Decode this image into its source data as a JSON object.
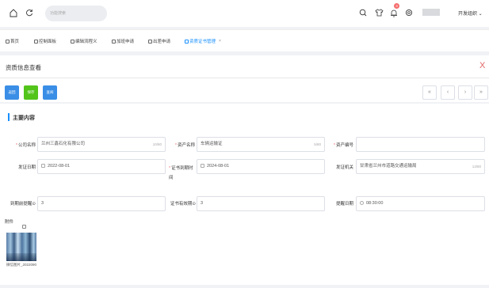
{
  "header": {
    "search_placeholder": "功能搜索",
    "notification_count": "3",
    "org_label": "开发组织"
  },
  "tabs": [
    {
      "label": "首页"
    },
    {
      "label": "控制面板"
    },
    {
      "label": "编辑流程义"
    },
    {
      "label": "加班申请"
    },
    {
      "label": "出差申请"
    },
    {
      "label": "资质证书管理"
    }
  ],
  "panel": {
    "title": "资质信息查看",
    "close_glyph": "X"
  },
  "actions": {
    "return_label": "返回",
    "save_label": "保存",
    "view_label": "查阅"
  },
  "pager": [
    "«",
    "‹",
    "›",
    "»"
  ],
  "section": {
    "title": "主要内容"
  },
  "form": {
    "company_name_label": "公司名称",
    "company_name_value": "兰州三鑫石化有限公司",
    "company_name_count": "10/80",
    "asset_name_label": "资产名称",
    "asset_name_value": "车辆运输证",
    "asset_name_count": "5/80",
    "asset_no_label": "资产编号",
    "asset_no_value": "",
    "issue_date_label": "发证日期",
    "issue_date_value": "2022-08-01",
    "expire_label": "证书到期时间",
    "expire_value": "2024-08-01",
    "authority_label": "发证机关",
    "authority_value": "甘肃省兰州市道路交通运输局",
    "authority_count": "13/80",
    "remind_label": "到期前提醒⊙",
    "remind_value": "3",
    "valid_label": "证书有效期⊙",
    "valid_value": "3",
    "remind_time_label": "提醒日期",
    "remind_time_value": "08:30:00"
  },
  "attachment": {
    "label": "附件",
    "filename": "微信图片_20220901160.jpg"
  }
}
